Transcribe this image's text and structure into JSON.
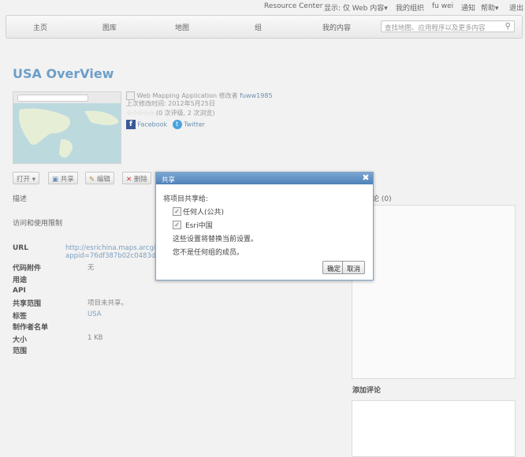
{
  "topbar": {
    "resource_center": "Resource Center",
    "display": "显示: 仅 Web 内容▾",
    "my_org": "我的组织",
    "user": "fu wei",
    "notify": "通知",
    "help": "帮助▾",
    "logout": "退出"
  },
  "nav": {
    "home": "主页",
    "gallery": "图库",
    "map": "地图",
    "groups": "组",
    "my_content": "我的内容",
    "search_placeholder": "查找地图、应用程序以及更多内容"
  },
  "item": {
    "title": "USA OverView",
    "type_line_prefix": "Web Mapping Application 修改者",
    "owner": "fuww1985",
    "modified": "上次修改时间: 2012年5月25日",
    "rating": "(0 次评级, 2 次浏览)",
    "facebook": "Facebook",
    "twitter": "Twitter"
  },
  "toolbar": {
    "open": "打开 ▾",
    "share": "共享",
    "edit": "编辑",
    "delete": "删除"
  },
  "details": {
    "description": "描述",
    "access": "访问和使用限制",
    "url_label": "URL",
    "url_value_1": "http://esrichina.maps.arcgis",
    "url_value_2": "appid=76df387b02c0483d9",
    "code_label": "代码附件",
    "code_value": "无",
    "use_label": "用途",
    "api_label": "API",
    "share_label": "共享范围",
    "share_value": "项目未共享。",
    "tags_label": "标签",
    "tags_value": "USA",
    "credits_label": "制作者名单",
    "size_label": "大小",
    "size_value": "1 KB",
    "extent_label": "范围"
  },
  "comments": {
    "header": "论 (0)",
    "add": "添加评论"
  },
  "dialog": {
    "title": "共享",
    "prompt": "将项目共享给:",
    "everyone": "任何人(公共)",
    "org": "Esri中国",
    "note1": "这些设置将替换当前设置。",
    "note2": "您不是任何组的成员。",
    "ok": "确定",
    "cancel": "取消"
  }
}
